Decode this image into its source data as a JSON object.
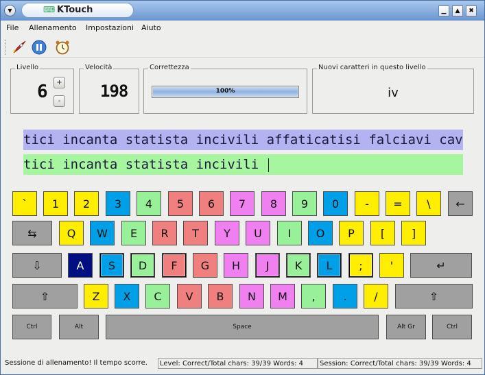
{
  "window": {
    "title": "KTouch",
    "title_icon": "ktouch-icon",
    "buttons": [
      "minimize",
      "maximize",
      "close"
    ]
  },
  "menu": {
    "items": [
      "File",
      "Allenamento",
      "Impostazioni",
      "Aiuto"
    ]
  },
  "toolbar": {
    "items": [
      "start-training-icon",
      "pause-icon",
      "clock-icon"
    ]
  },
  "stats": {
    "level_label": "Livello",
    "level_value": "6",
    "level_up": "+",
    "level_down": "-",
    "speed_label": "Velocità",
    "speed_value": "198",
    "accuracy_label": "Correttezza",
    "accuracy_value": "100%",
    "accuracy_fraction": 1.0,
    "new_chars_label": "Nuovi caratteri in questo livello",
    "new_chars_value": "iv"
  },
  "lines": {
    "teacher": "tici incanta statista incivili affaticatisi falciavi cavall",
    "student": "tici incanta statista incivili "
  },
  "keyboard": {
    "row1": [
      "`",
      "1",
      "2",
      "3",
      "4",
      "5",
      "6",
      "7",
      "8",
      "9",
      "0",
      "-",
      "=",
      "\\",
      "←"
    ],
    "row2": [
      "⇆",
      "Q",
      "W",
      "E",
      "R",
      "T",
      "Y",
      "U",
      "I",
      "O",
      "P",
      "[",
      "]"
    ],
    "row3": [
      "⇩",
      "A",
      "S",
      "D",
      "F",
      "G",
      "H",
      "J",
      "K",
      "L",
      ";",
      "'",
      "↵"
    ],
    "row4": [
      "⇧",
      "Z",
      "X",
      "C",
      "V",
      "B",
      "N",
      "M",
      ",",
      ".",
      "/",
      "⇧"
    ],
    "row5": [
      "Ctrl",
      "Alt",
      "Space",
      "Alt Gr",
      "Ctrl"
    ],
    "colors": {
      "yellow": "#ffee00",
      "blue": "#00a0e8",
      "green": "#98f098",
      "red": "#f08080",
      "pink": "#f080f0",
      "grey": "#a0a0a0",
      "active": "#001080"
    }
  },
  "status": {
    "message": "Sessione di allenamento! Il tempo scorre.",
    "level_stats": "Level:  Correct/Total chars: 39/39  Words: 4",
    "session_stats": "Session: Correct/Total chars: 39/39  Words: 4"
  }
}
